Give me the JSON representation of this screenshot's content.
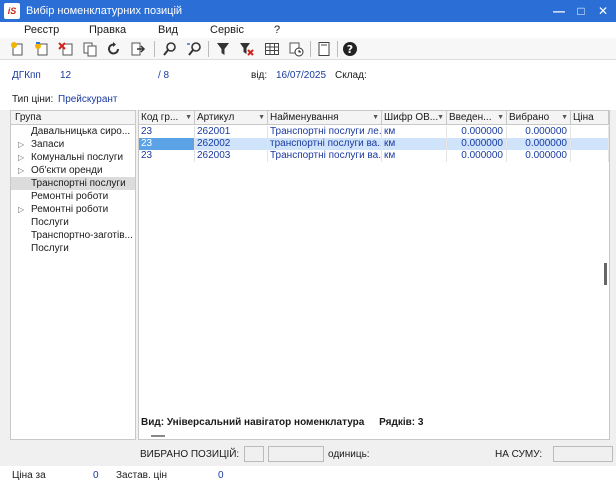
{
  "window": {
    "title": "Вибір номенклатурних позицій",
    "app_icon_text": "iS"
  },
  "menu": [
    "Реєстр",
    "Правка",
    "Вид",
    "Сервіс",
    "?"
  ],
  "toolbar_icons": [
    "create-icon",
    "create-copy-icon",
    "delete-icon",
    "copy-icon",
    "refresh-icon",
    "export-icon",
    "search-icon",
    "search-next-icon",
    "filter-icon",
    "clear-filter-icon",
    "table-icon",
    "calendar-clock-icon",
    "document-icon",
    "help-icon"
  ],
  "header": {
    "doc_label": "ДГКпп",
    "doc_number": "12",
    "doc_slash": "/ 8",
    "date_label": "від:",
    "date_value": "16/07/2025",
    "warehouse_label": "Склад:",
    "price_type_label": "Тип ціни:",
    "price_type_value": "Прейскурант"
  },
  "groups": {
    "header": "Група",
    "items": [
      {
        "label": "Давальницька сиро...",
        "expandable": false,
        "selected": false
      },
      {
        "label": "Запаси",
        "expandable": true,
        "selected": false
      },
      {
        "label": "Комунальні послуги",
        "expandable": true,
        "selected": false
      },
      {
        "label": "Об'єкти оренди",
        "expandable": true,
        "selected": false
      },
      {
        "label": "Транспортні послуги",
        "expandable": false,
        "selected": true
      },
      {
        "label": "Ремонтні роботи",
        "expandable": false,
        "selected": false
      },
      {
        "label": "Ремонтні роботи",
        "expandable": true,
        "selected": false
      },
      {
        "label": "Послуги",
        "expandable": false,
        "selected": false
      },
      {
        "label": "Транспортно-заготів...",
        "expandable": false,
        "selected": false
      },
      {
        "label": "Послуги",
        "expandable": false,
        "selected": false
      }
    ]
  },
  "grid": {
    "columns": [
      "Код гр...",
      "Артикул",
      "Найменування",
      "Шифр ОВ...",
      "Введен...",
      "Вибрано",
      "Ціна"
    ],
    "rows": [
      {
        "group_code": "23",
        "article": "262001",
        "name": "Транспортні послуги ле...",
        "unit": "км",
        "entered": "0.000000",
        "selected_qty": "0.000000",
        "price": ""
      },
      {
        "group_code": "23",
        "article": "262002",
        "name": "транспортні послуги ва...",
        "unit": "км",
        "entered": "0.000000",
        "selected_qty": "0.000000",
        "price": ""
      },
      {
        "group_code": "23",
        "article": "262003",
        "name": "Транспортні послуги ва...",
        "unit": "км",
        "entered": "0.000000",
        "selected_qty": "0.000000",
        "price": ""
      }
    ],
    "selected_row": 1,
    "footer_view": "Вид: Універсальний навігатор номенклатура",
    "footer_rows": "Рядків: 3"
  },
  "selection": {
    "positions_label": "ВИБРАНО ПОЗИЦІЙ:",
    "units_label": "одиниць:",
    "sum_label": "НА СУМУ:"
  },
  "status": {
    "price_label": "Ціна за",
    "price_value": "0",
    "accounting_price_label": "Застав. цін",
    "accounting_price_value": "0"
  },
  "colors": {
    "titlebar": "#2b6fd6",
    "value_text": "#1a3aa0",
    "selected_row": "#cfe3fa",
    "focus_cell": "#5ba3e6"
  }
}
